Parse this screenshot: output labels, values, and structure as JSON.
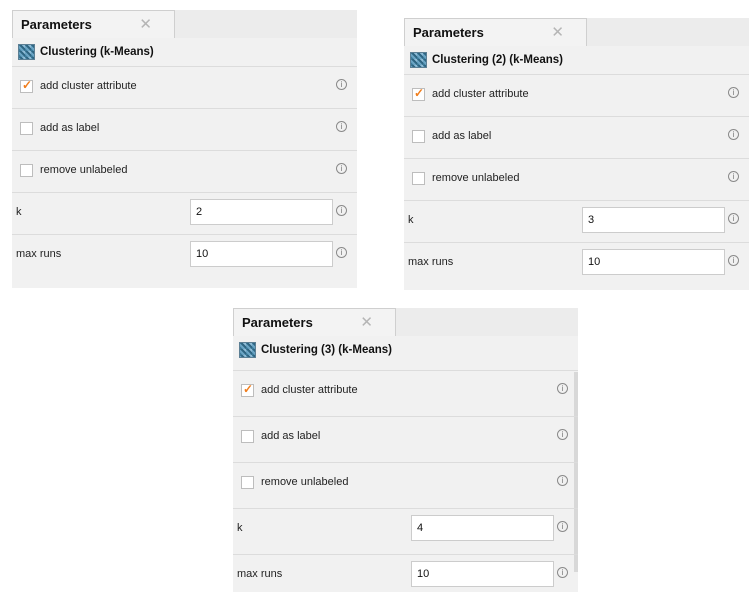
{
  "panels": [
    {
      "tab_label": "Parameters",
      "operator": "Clustering (k-Means)",
      "add_cluster_attribute": "add cluster attribute",
      "add_as_label": "add as label",
      "remove_unlabeled": "remove unlabeled",
      "k_label": "k",
      "k_value": "2",
      "max_runs_label": "max runs",
      "max_runs_value": "10",
      "checked": [
        true,
        false,
        false
      ]
    },
    {
      "tab_label": "Parameters",
      "operator": "Clustering (2) (k-Means)",
      "add_cluster_attribute": "add cluster attribute",
      "add_as_label": "add as label",
      "remove_unlabeled": "remove unlabeled",
      "k_label": "k",
      "k_value": "3",
      "max_runs_label": "max runs",
      "max_runs_value": "10",
      "checked": [
        true,
        false,
        false
      ]
    },
    {
      "tab_label": "Parameters",
      "operator": "Clustering (3) (k-Means)",
      "add_cluster_attribute": "add cluster attribute",
      "add_as_label": "add as label",
      "remove_unlabeled": "remove unlabeled",
      "k_label": "k",
      "k_value": "4",
      "max_runs_label": "max runs",
      "max_runs_value": "10",
      "checked": [
        true,
        false,
        false
      ]
    }
  ],
  "icons": {
    "close": "close-icon",
    "operator": "clustering-icon",
    "info": "info-icon",
    "check": "checkmark-icon"
  },
  "colors": {
    "check": "#f07d1c",
    "panel_bg": "#f1f1f1"
  }
}
